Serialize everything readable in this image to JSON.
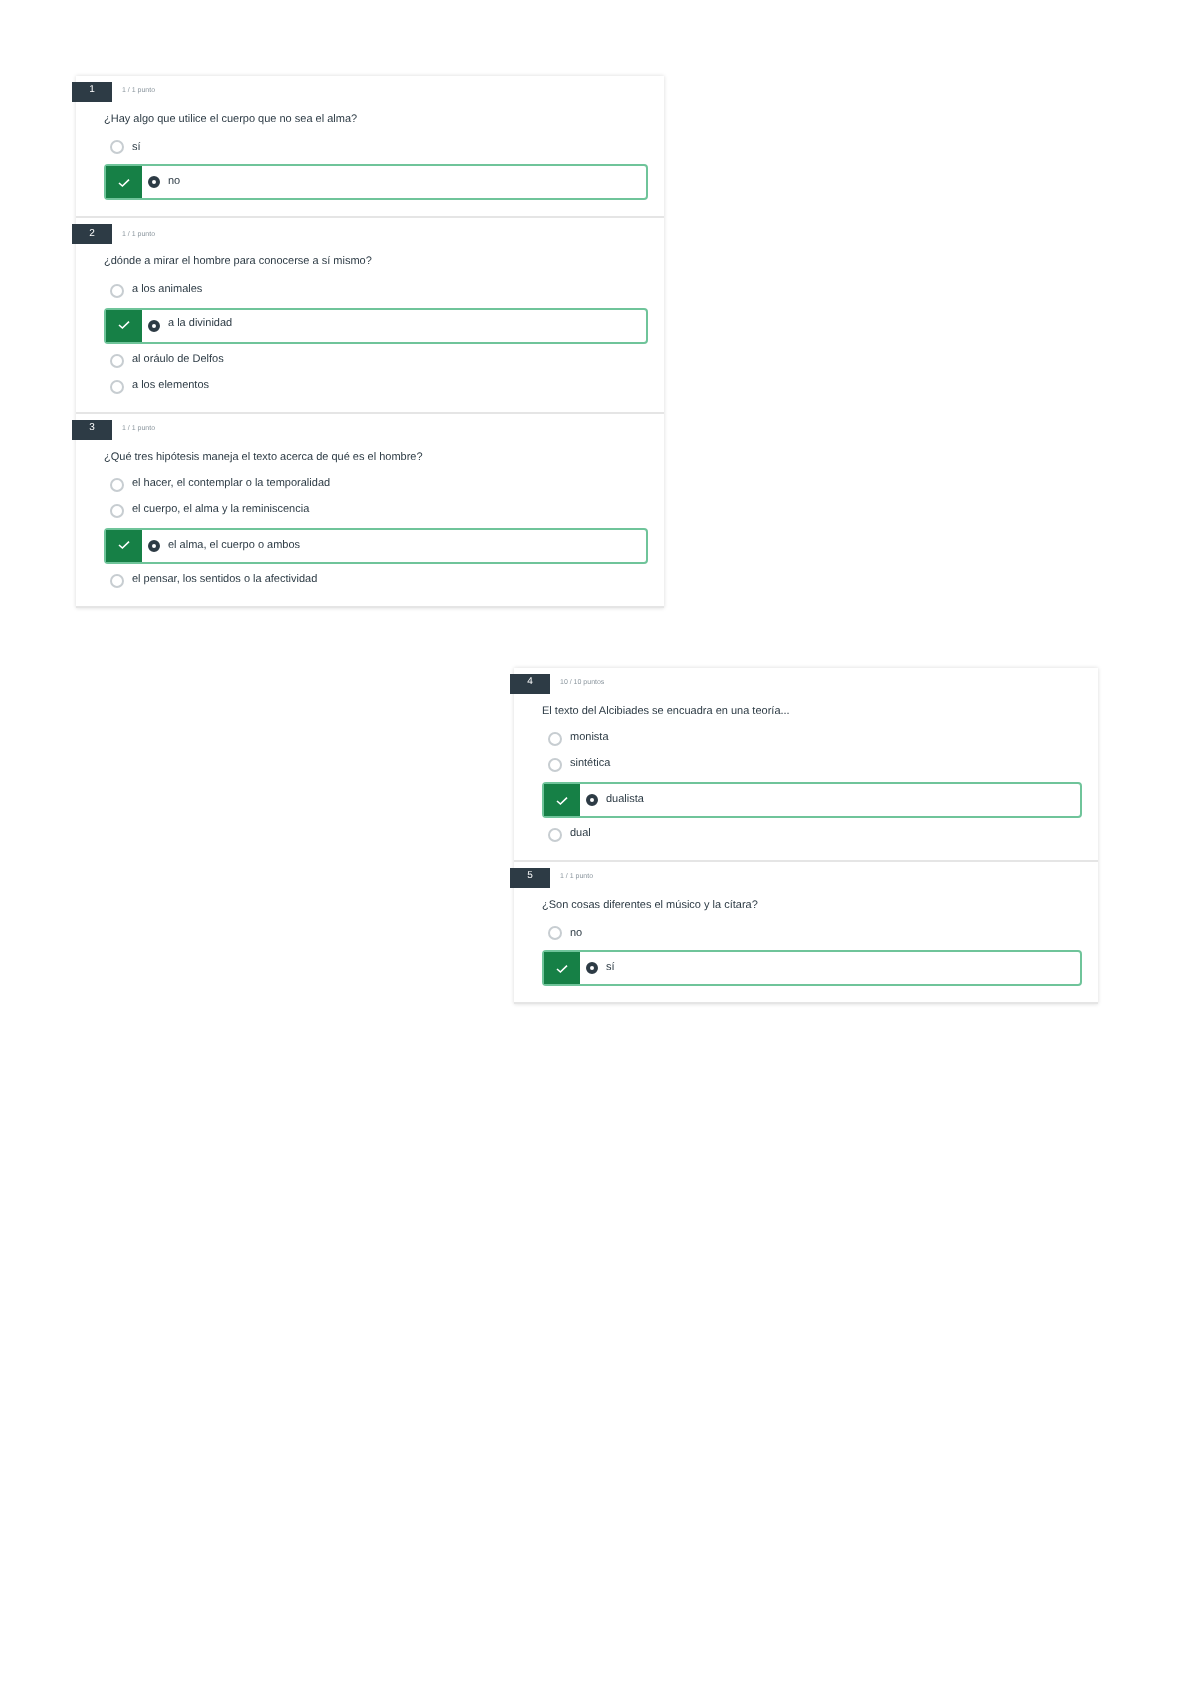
{
  "panels": [
    {
      "questions": [
        {
          "number": "1",
          "score": "1 / 1 punto",
          "text": "¿Hay algo que utilice el cuerpo que no sea el alma?",
          "options": [
            {
              "label": "sí",
              "selected": false
            },
            {
              "label": "no",
              "selected": true
            }
          ]
        },
        {
          "number": "2",
          "score": "1 / 1 punto",
          "text": "¿dónde a mirar el hombre para conocerse a sí mismo?",
          "options": [
            {
              "label": "a los animales",
              "selected": false
            },
            {
              "label": "a la divinidad",
              "selected": true
            },
            {
              "label": "al oráulo de Delfos",
              "selected": false
            },
            {
              "label": "a los elementos",
              "selected": false
            }
          ]
        },
        {
          "number": "3",
          "score": "1 / 1 punto",
          "text": "¿Qué tres hipótesis maneja el texto acerca de qué es el hombre?",
          "options": [
            {
              "label": "el hacer, el contemplar o la temporalidad",
              "selected": false
            },
            {
              "label": "el cuerpo, el alma y la reminiscencia",
              "selected": false
            },
            {
              "label": "el alma, el cuerpo o ambos",
              "selected": true
            },
            {
              "label": "el pensar, los sentidos o la afectividad",
              "selected": false
            }
          ]
        }
      ]
    },
    {
      "questions": [
        {
          "number": "4",
          "score": "10 / 10 puntos",
          "text": "El texto del Alcibiades se encuadra en una teoría...",
          "options": [
            {
              "label": "monista",
              "selected": false
            },
            {
              "label": "sintética",
              "selected": false
            },
            {
              "label": "dualista",
              "selected": true
            },
            {
              "label": "dual",
              "selected": false
            }
          ]
        },
        {
          "number": "5",
          "score": "1 / 1 punto",
          "text": "¿Son cosas diferentes el músico y la cítara?",
          "options": [
            {
              "label": "no",
              "selected": false
            },
            {
              "label": "sí",
              "selected": true
            }
          ]
        }
      ]
    }
  ]
}
